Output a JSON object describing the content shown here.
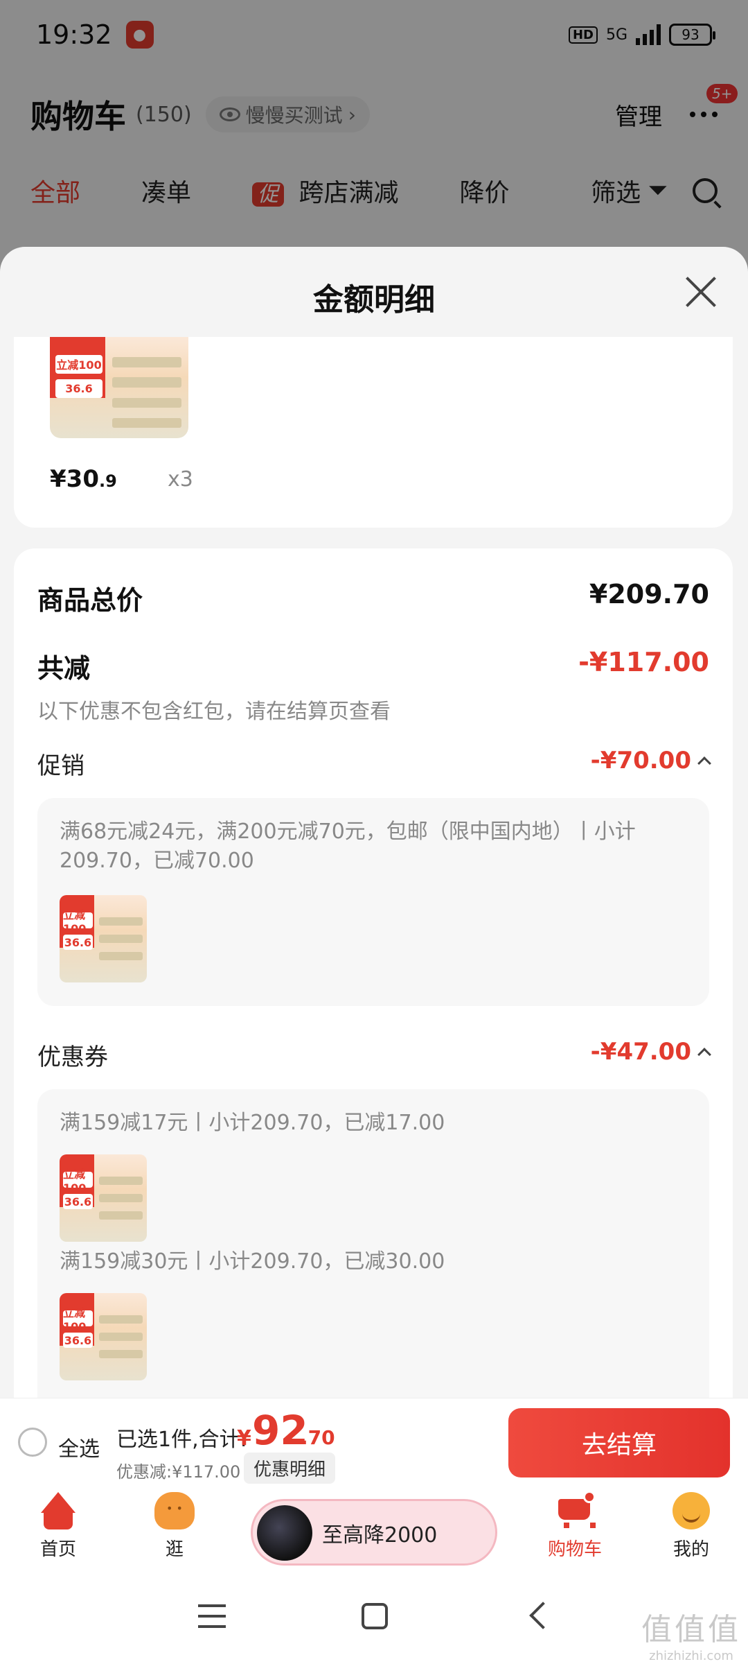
{
  "status_bar": {
    "time": "19:32",
    "hd": "HD",
    "network": "5G",
    "battery": "93"
  },
  "cart_header": {
    "title": "购物车",
    "count": "(150)",
    "slow_buy": "慢慢买测试",
    "manage": "管理",
    "more_badge": "5+"
  },
  "tabs": {
    "all": "全部",
    "bundle": "凑单",
    "promo_tag": "促",
    "cross_store": "跨店满减",
    "price_drop": "降价",
    "filter": "筛选"
  },
  "sheet": {
    "title": "金额明细",
    "product": {
      "price_int": "¥30",
      "price_dec": ".9",
      "quantity": "x3"
    },
    "summary": {
      "total_label": "商品总价",
      "total_value": "¥209.70",
      "reduction_label": "共减",
      "reduction_value": "-¥117.00",
      "note": "以下优惠不包含红包，请在结算页查看"
    },
    "promotion": {
      "label": "促销",
      "value": "-¥70.00",
      "detail": "满68元减24元，满200元减70元，包邮（限中国内地）丨小计209.70，已减70.00"
    },
    "coupon": {
      "label": "优惠券",
      "value": "-¥47.00",
      "items": [
        {
          "detail": "满159减17元丨小计209.70，已减17.00"
        },
        {
          "detail": "满159减30元丨小计209.70，已减30.00"
        }
      ]
    },
    "thumb_texts": {
      "badge_a": "立减100",
      "badge_b": "36.6"
    }
  },
  "checkout": {
    "select_all": "全选",
    "selected": "已选1件,合计:",
    "total_symbol": "¥",
    "total_int": "92",
    "total_dec": ".70",
    "discount_line": "优惠减:¥117.00",
    "discount_detail": "优惠明细",
    "checkout_button": "去结算"
  },
  "bottom_nav": {
    "home": "首页",
    "browse": "逛",
    "promo": "至高降2000",
    "cart": "购物车",
    "me": "我的"
  },
  "watermark": {
    "big": "值值值",
    "small": "zhizhizhi.com"
  },
  "colors": {
    "accent": "#e23b2e",
    "sheet_bg": "#f4f4f4",
    "detail_box": "#f7f7f7"
  }
}
